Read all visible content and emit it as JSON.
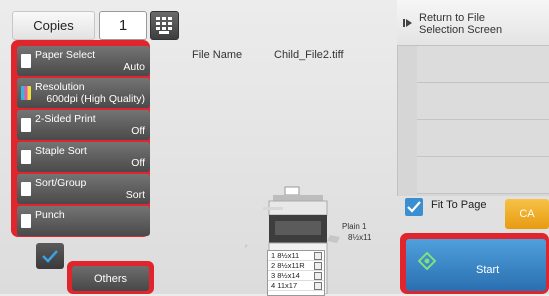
{
  "copies": {
    "label": "Copies",
    "value": "1"
  },
  "functions": [
    {
      "label": "Paper Select",
      "value": "Auto"
    },
    {
      "label": "Resolution",
      "value": "600dpi (High Quality)"
    },
    {
      "label": "2-Sided Print",
      "value": "Off"
    },
    {
      "label": "Staple Sort",
      "value": "Off"
    },
    {
      "label": "Sort/Group",
      "value": "Sort"
    },
    {
      "label": "Punch",
      "value": ""
    }
  ],
  "others": {
    "label": "Others"
  },
  "file": {
    "name_label": "File Name",
    "name_value": "Child_File2.tiff"
  },
  "return": {
    "line1": "Return to File",
    "line2": "Selection Screen"
  },
  "fit": {
    "label": "Fit To Page",
    "checked": true
  },
  "ca": {
    "label": "CA"
  },
  "start": {
    "label": "Start"
  },
  "trays": [
    {
      "num": "1",
      "size": "8½x11"
    },
    {
      "num": "2",
      "size": "8½x11R"
    },
    {
      "num": "3",
      "size": "8½x14"
    },
    {
      "num": "4",
      "size": "11x17"
    }
  ],
  "output": {
    "paper": "Plain 1",
    "size": "8½x11"
  },
  "colors": {
    "highlight": "#e1252d",
    "start": "#3a88cc",
    "ca": "#f0aa20",
    "check": "#3b8fd0"
  }
}
